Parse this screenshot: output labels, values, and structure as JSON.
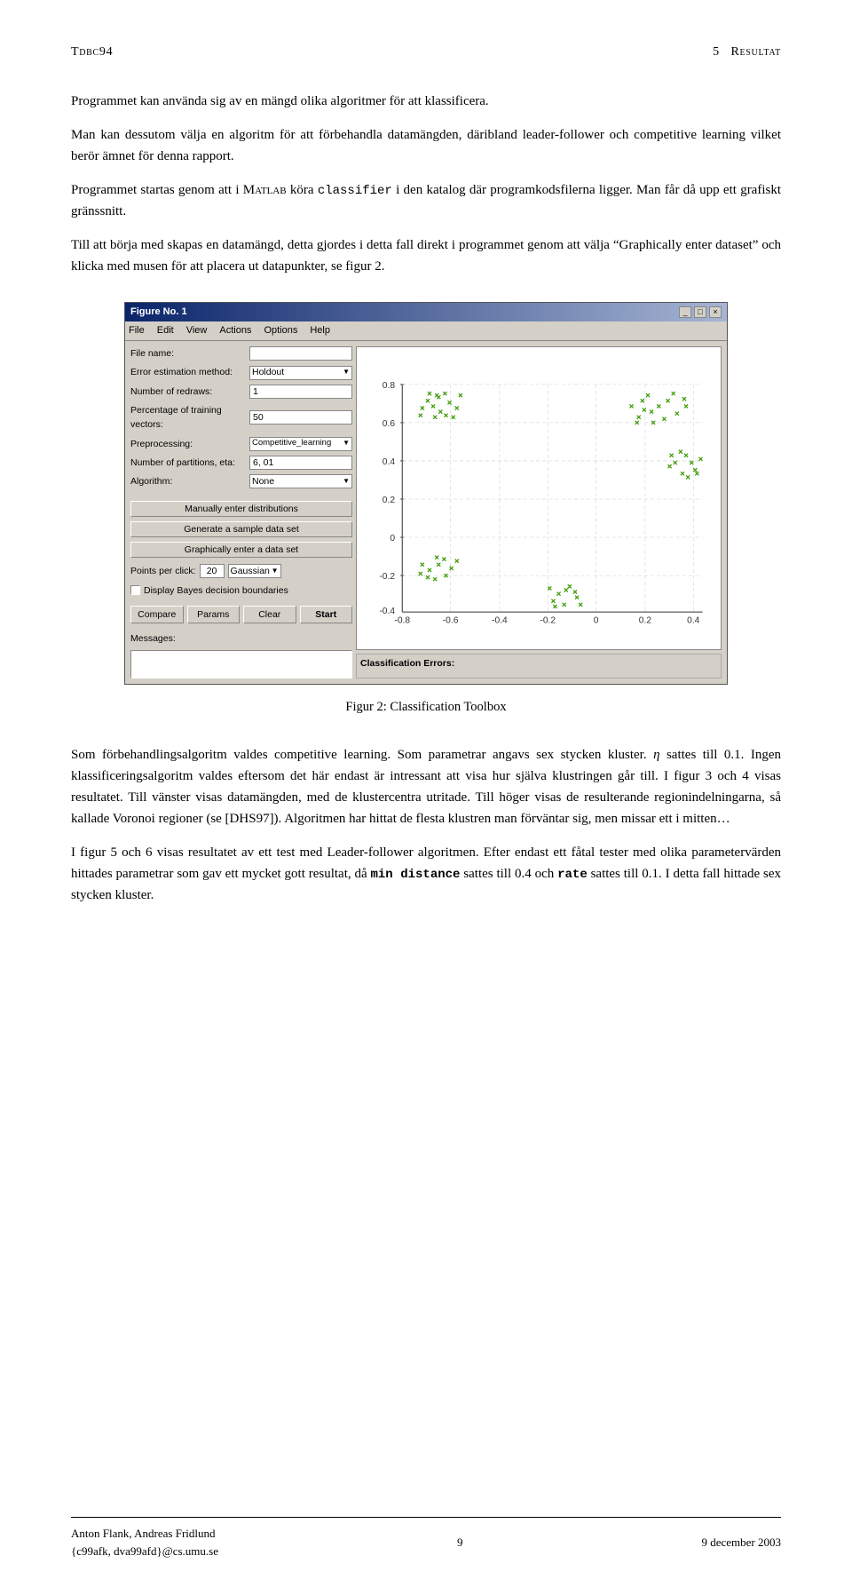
{
  "header": {
    "left": "Tdbc94",
    "right": "5  Resultat",
    "left_display": "Tᴅʙᴄ94",
    "right_display": "5  Rᴇsᴛᴛᴀᴛ"
  },
  "paragraphs": [
    {
      "id": "p1",
      "text": "Programmet kan använda sig av en mängd olika algoritmer för att klassificera."
    },
    {
      "id": "p2",
      "text": "Man kan dessutom välja en algoritm för att förbehandla datamängden, däribland leader-follower och competitive learning vilket berör ämnet för denna rapport."
    },
    {
      "id": "p3",
      "text": "Programmet startas genom att i Matlab köra classifier i den katalog där programkodsfilerna ligger. Man får då upp ett grafiskt gränssnitt."
    },
    {
      "id": "p4",
      "text": "Till att börja med skapas en datamängd, detta gjordes i detta fall direkt i programmet genom att välja “Graphically enter dataset” och klicka med musen för att placera ut datapunkter, se figur 2."
    }
  ],
  "figure": {
    "number": "2",
    "caption": "Figur 2: Classification Toolbox",
    "window_title": "Figure No. 1",
    "menubar": [
      "File",
      "Edit",
      "View",
      "Actions",
      "Options",
      "Help"
    ],
    "form_fields": [
      {
        "label": "File name:",
        "value": "",
        "type": "input"
      },
      {
        "label": "Error estimation method:",
        "value": "Holdout",
        "type": "dropdown"
      },
      {
        "label": "Number of redraws:",
        "value": "1",
        "type": "input"
      },
      {
        "label": "Percentage of training vectors:",
        "value": "50",
        "type": "input"
      },
      {
        "label": "Preprocessing:",
        "value": "Competitive_learning",
        "type": "dropdown"
      },
      {
        "label": "Number of partitions, eta:",
        "value": "6, 01",
        "type": "input"
      },
      {
        "label": "Algorithm:",
        "value": "None",
        "type": "dropdown"
      }
    ],
    "action_buttons": [
      "Manually enter distributions",
      "Generate a sample data set",
      "Graphically enter a data set"
    ],
    "points_label": "Points per click:",
    "points_value": "20",
    "gaussian_label": "Gaussian",
    "checkbox_label": "Display Bayes decision boundaries",
    "bottom_buttons": [
      "Compare",
      "Params",
      "Clear",
      "Start"
    ],
    "messages_label": "Messages:",
    "classification_errors_label": "Classification Errors:"
  },
  "post_figure_paragraphs": [
    {
      "id": "pf1",
      "text": "Som förbehandlingsalgoritm valdes competitive learning. Som parametrar angavs sex stycken kluster. η sattes till 0.1. Ingen klassificeringsalgoritm valdes eftersom det här endast är intressant att visa hur själva klustringen går till. I figur 3 och 4 visas resultatet. Till vänster visas datamängden, med de klustercentra utritade. Till höger visas de resulterande regionindelningarna, så kallade Voronoi regioner (se [DHS97]). Algoritmen har hittat de flesta klustren man förväntar sig, men missar ett i mitten…"
    },
    {
      "id": "pf2",
      "text": "I figur 5 och 6 visas resultatet av ett test med Leader-follower algoritmen. Efter endast ett fåtal tester med olika parametervärden hittades parametrar som gav ett mycket gott resultat, då min distance sattes till 0.4 och rate sattes till 0.1. I detta fall hittade sex stycken kluster."
    }
  ],
  "footer": {
    "left": "Anton Flank, Andreas Fridlund",
    "left_sub": "{c99afk, dva99afd}@cs.umu.se",
    "center": "9",
    "right": "9 december 2003"
  },
  "colors": {
    "accent_green": "#3a9a00",
    "window_bg": "#d4d0c8",
    "titlebar_start": "#0a246a",
    "titlebar_end": "#a6b5d4"
  }
}
